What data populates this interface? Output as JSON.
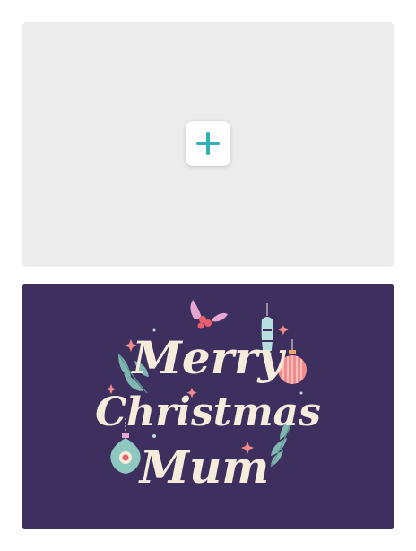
{
  "upload_card": {
    "add_icon": "plus-icon",
    "accent": "#2fb3b9",
    "background": "#ececec"
  },
  "card_design": {
    "background": "#3d305f",
    "text_color": "#f6ecdb",
    "greeting": {
      "line1": "Merry",
      "line2": "Christmas",
      "line3": "Mum"
    },
    "decorations": [
      "holly-berries-icon",
      "holly-leaf-icon",
      "bauble-striped-icon",
      "bauble-long-icon",
      "bauble-teal-icon",
      "sparkle-icon"
    ]
  }
}
